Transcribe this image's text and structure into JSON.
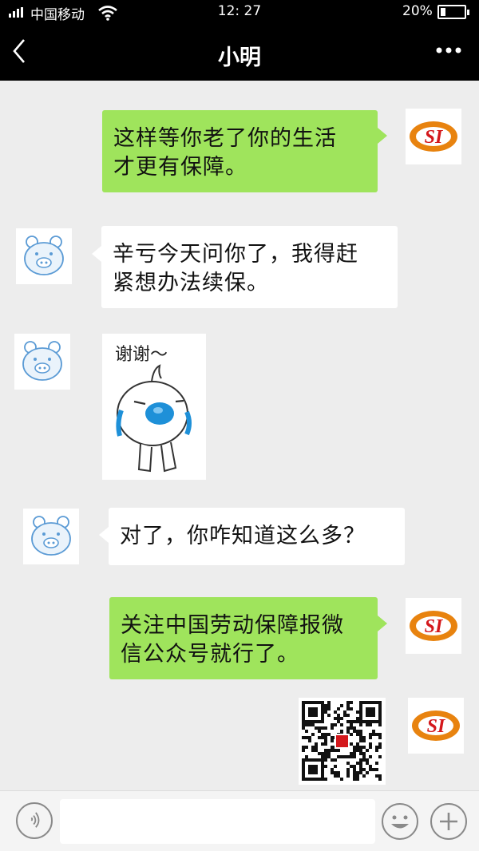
{
  "status_bar": {
    "carrier": "中国移动",
    "time": "12: 27",
    "battery_percent": "20%",
    "battery_level": 0.2,
    "signal_icon": "signal-bars-icon",
    "wifi_icon": "wifi-icon",
    "battery_icon": "battery-icon"
  },
  "header": {
    "title": "小明",
    "back_icon": "chevron-left-icon",
    "more_icon": "more-dots-icon"
  },
  "messages": [
    {
      "side": "right",
      "type": "text",
      "lines": [
        "这样等你老了你的生活",
        "才更有保障。"
      ]
    },
    {
      "side": "left",
      "type": "text",
      "lines": [
        "辛亏今天问你了，我得赶",
        "紧想办法续保。"
      ]
    },
    {
      "side": "left",
      "type": "sticker",
      "caption": "谢谢～"
    },
    {
      "side": "left",
      "type": "text",
      "lines": [
        "对了，你咋知道这么多？"
      ]
    },
    {
      "side": "right",
      "type": "text",
      "lines": [
        "关注中国劳动保障报微",
        "信公众号就行了。"
      ]
    },
    {
      "side": "right",
      "type": "image",
      "content": "qr-code"
    }
  ],
  "avatars": {
    "self_logo_text": "SI",
    "contact": "pig-avatar-icon"
  },
  "input_bar": {
    "placeholder": "",
    "voice_icon": "voice-icon",
    "emoji_icon": "emoji-icon",
    "plus_icon": "plus-icon"
  },
  "colors": {
    "green_bubble": "#9fe45c",
    "white_bubble": "#ffffff",
    "background": "#ededed",
    "header": "#000000"
  }
}
